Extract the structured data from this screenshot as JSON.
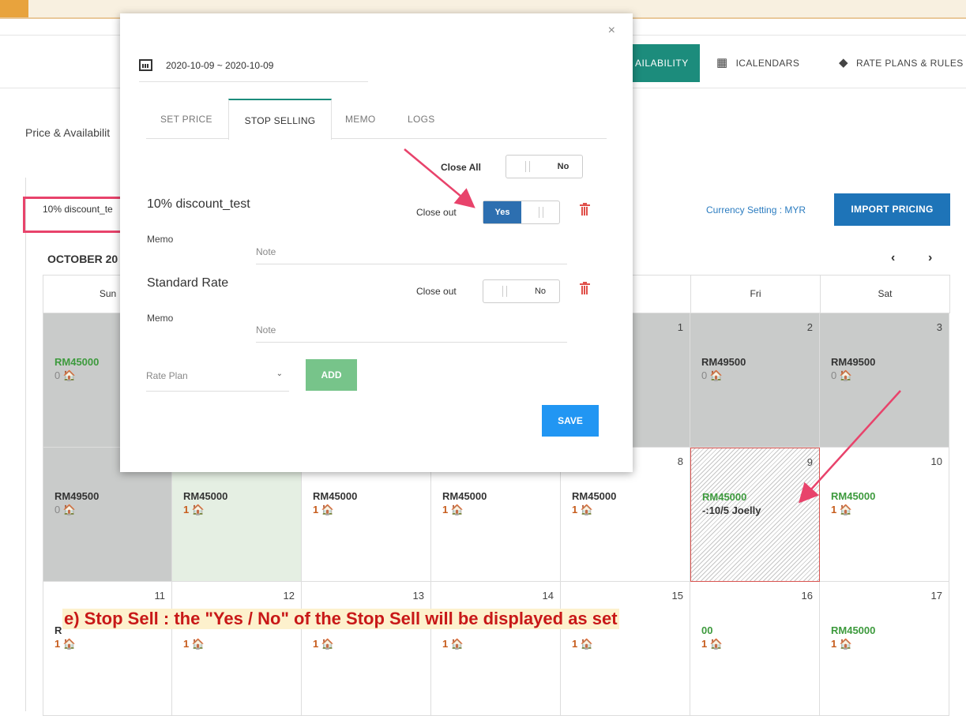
{
  "nav": {
    "availability": "AILABILITY",
    "icalendars": "ICALENDARS",
    "rate_plans": "RATE PLANS & RULES"
  },
  "page": {
    "title": "Price & Availabilit",
    "plan_select": "10% discount_te",
    "currency_setting": "Currency Setting : MYR",
    "import_pricing": "IMPORT PRICING",
    "month": "OCTOBER 20"
  },
  "calendar": {
    "headers": [
      "Sun",
      "",
      "",
      "",
      "",
      "Fri",
      "Sat"
    ],
    "weeks": [
      [
        {
          "day": "",
          "price": "RM45000",
          "avail": "0 🏠",
          "style": "gray",
          "price_green": true,
          "zero": true
        },
        {
          "day": "",
          "price": "",
          "avail": "",
          "style": "gray"
        },
        {
          "day": "",
          "price": "",
          "avail": "",
          "style": "gray"
        },
        {
          "day": "",
          "price": "",
          "avail": "",
          "style": "gray"
        },
        {
          "day": "1",
          "price": "",
          "avail": "",
          "style": "gray"
        },
        {
          "day": "2",
          "price": "RM49500",
          "avail": "0 🏠",
          "style": "gray",
          "zero": true
        },
        {
          "day": "3",
          "price": "RM49500",
          "avail": "0 🏠",
          "style": "gray",
          "zero": true
        }
      ],
      [
        {
          "day": "",
          "price": "RM49500",
          "avail": "0 🏠",
          "style": "gray",
          "zero": true
        },
        {
          "day": "",
          "price": "RM45000",
          "avail": "1 🏠",
          "style": "green"
        },
        {
          "day": "",
          "price": "RM45000",
          "avail": "1 🏠",
          "style": ""
        },
        {
          "day": "",
          "price": "RM45000",
          "avail": "1 🏠",
          "style": ""
        },
        {
          "day": "8",
          "price": "RM45000",
          "avail": "1 🏠",
          "style": ""
        },
        {
          "day": "9",
          "price": "RM45000",
          "note": "-:10/5 Joelly",
          "style": "hatch",
          "price_green": true
        },
        {
          "day": "10",
          "price": "RM45000",
          "avail": "1 🏠",
          "style": "",
          "price_green": true
        }
      ],
      [
        {
          "day": "11",
          "price": "R",
          "avail": "1 🏠",
          "style": ""
        },
        {
          "day": "12",
          "price": "",
          "avail": "1 🏠",
          "style": ""
        },
        {
          "day": "13",
          "price": "",
          "avail": "1 🏠",
          "style": ""
        },
        {
          "day": "14",
          "price": "",
          "avail": "1 🏠",
          "style": ""
        },
        {
          "day": "15",
          "price": "",
          "avail": "1 🏠",
          "style": ""
        },
        {
          "day": "16",
          "price": "00",
          "avail": "1 🏠",
          "style": "",
          "price_green": true
        },
        {
          "day": "17",
          "price": "RM45000",
          "avail": "1 🏠",
          "style": "",
          "price_green": true
        }
      ]
    ]
  },
  "caption": "e) Stop Sell : the \"Yes / No\" of the Stop Sell  will be displayed as set",
  "modal": {
    "close": "×",
    "date_range": "2020-10-09 ~ 2020-10-09",
    "tabs": [
      "SET PRICE",
      "STOP SELLING",
      "MEMO",
      "LOGS"
    ],
    "close_all_label": "Close All",
    "close_all_value": "No",
    "plans": [
      {
        "name": "10% discount_test",
        "close_out_label": "Close out",
        "close_out_value": "Yes",
        "memo_label": "Memo",
        "note_placeholder": "Note"
      },
      {
        "name": "Standard Rate",
        "close_out_label": "Close out",
        "close_out_value": "No",
        "memo_label": "Memo",
        "note_placeholder": "Note"
      }
    ],
    "rate_plan_placeholder": "Rate Plan",
    "add_label": "ADD",
    "save_label": "SAVE"
  },
  "colors": {
    "accent": "#1c8c7c",
    "import_button": "#1e74b8",
    "save_button": "#2196f3",
    "add_button": "#77c48a",
    "highlight": "#e8436b"
  }
}
